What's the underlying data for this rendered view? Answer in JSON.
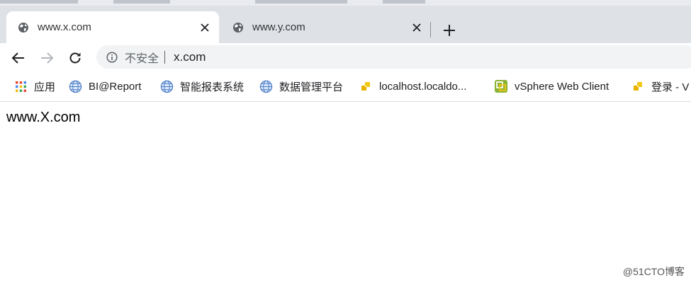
{
  "tabs": [
    {
      "title": "www.x.com",
      "icon": "globe-icon",
      "active": true
    },
    {
      "title": "www.y.com",
      "icon": "globe-icon",
      "active": false
    }
  ],
  "toolbar": {
    "security_label": "不安全",
    "url": "x.com"
  },
  "bookmarks": [
    {
      "label": "应用",
      "icon": "apps-grid-icon"
    },
    {
      "label": "BI@Report",
      "icon": "globe-icon"
    },
    {
      "label": "智能报表系统",
      "icon": "globe-icon"
    },
    {
      "label": "数据管理平台",
      "icon": "globe-icon"
    },
    {
      "label": "localhost.localdo...",
      "icon": "cube-icon"
    },
    {
      "label": "vSphere Web Client",
      "icon": "vsphere-icon"
    },
    {
      "label": "登录 - V",
      "icon": "cube-icon"
    }
  ],
  "page": {
    "text": "www.X.com"
  },
  "watermark": "@51CTO博客",
  "colors": {
    "tabbar": "#dee1e6",
    "omnibox": "#f1f3f4",
    "apps_red": "#ea4335",
    "apps_blue": "#4285f4",
    "apps_yellow": "#fbbc05",
    "apps_green": "#34a853",
    "cube_yellow": "#f2c811",
    "vsphere_green": "#8bb236"
  }
}
